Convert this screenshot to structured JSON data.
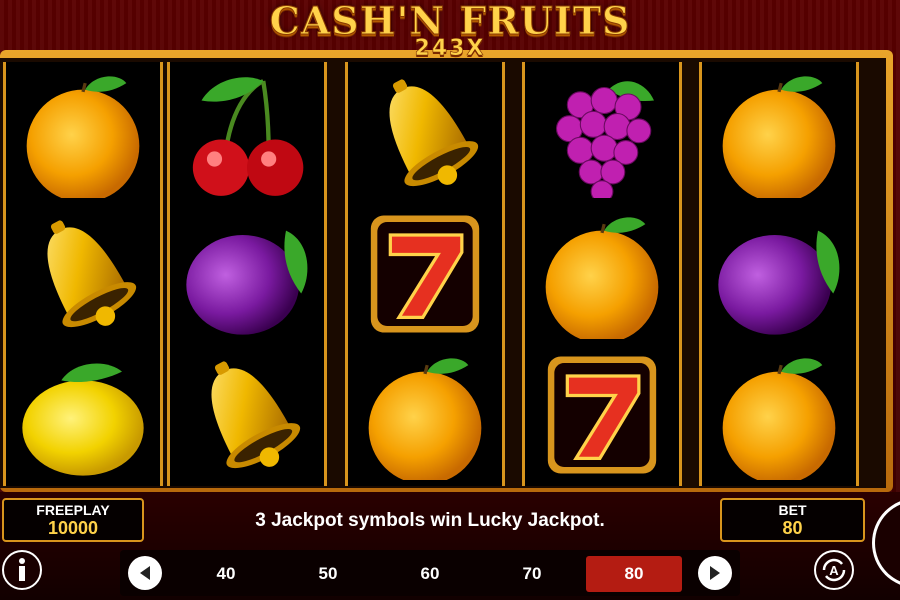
{
  "game": {
    "title": "CASH'N FRUITS",
    "subtitle": "243X"
  },
  "reels": [
    {
      "symbols": [
        "orange-icon",
        "bell-icon",
        "lemon-icon"
      ]
    },
    {
      "symbols": [
        "cherry-icon",
        "plum-icon",
        "bell-icon"
      ]
    },
    {
      "symbols": [
        "bell-icon",
        "seven-icon",
        "orange-icon"
      ]
    },
    {
      "symbols": [
        "grapes-icon",
        "orange-icon",
        "seven-icon"
      ]
    },
    {
      "symbols": [
        "orange-icon",
        "plum-icon",
        "orange-icon"
      ]
    }
  ],
  "freeplay": {
    "label": "FREEPLAY",
    "value": "10000"
  },
  "bet": {
    "label": "BET",
    "value": "80"
  },
  "message": "3 Jackpot symbols win Lucky Jackpot.",
  "bet_options": [
    "40",
    "50",
    "60",
    "70",
    "80"
  ],
  "selected_bet": "80",
  "colors": {
    "accent": "#d8951d",
    "selected": "#b41c12",
    "value": "#ffd24a"
  }
}
